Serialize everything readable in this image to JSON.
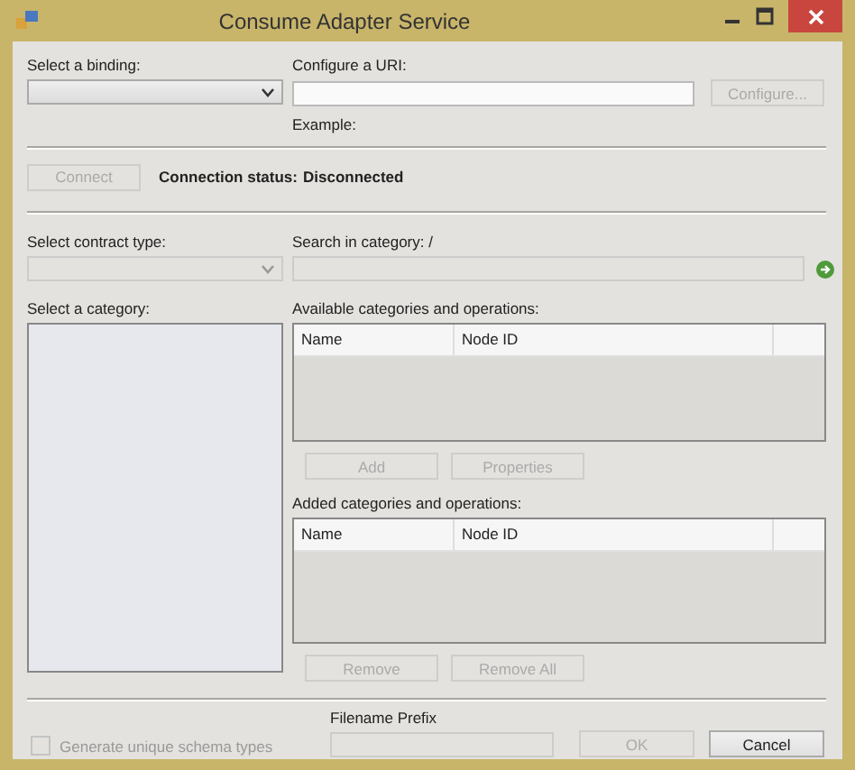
{
  "window": {
    "title": "Consume Adapter Service"
  },
  "binding": {
    "label": "Select a binding:",
    "disabled": false
  },
  "uri": {
    "label": "Configure a URI:",
    "example": "Example:"
  },
  "configure_button": {
    "label": "Configure...",
    "disabled": true
  },
  "connect_button": {
    "label": "Connect",
    "disabled": true
  },
  "connection_status": {
    "label": "Connection status:",
    "value": "Disconnected"
  },
  "contract_type": {
    "label": "Select contract type:",
    "disabled": true
  },
  "search": {
    "label": "Search in category: /"
  },
  "category": {
    "label": "Select a category:"
  },
  "available": {
    "label": "Available categories and operations:",
    "columns": [
      "Name",
      "Node ID"
    ]
  },
  "available_buttons": [
    {
      "label": "Add",
      "disabled": true
    },
    {
      "label": "Properties",
      "disabled": true
    }
  ],
  "added": {
    "label": "Added categories and operations:",
    "columns": [
      "Name",
      "Node ID"
    ]
  },
  "added_buttons": [
    {
      "label": "Remove",
      "disabled": true
    },
    {
      "label": "Remove All",
      "disabled": true
    }
  ],
  "unique_schema": {
    "label": "Generate unique schema types",
    "checked": false,
    "disabled": true
  },
  "filename_prefix": {
    "label": "Filename Prefix"
  },
  "dialog_buttons": [
    {
      "label": "OK",
      "disabled": true
    },
    {
      "label": "Cancel",
      "disabled": false
    }
  ]
}
